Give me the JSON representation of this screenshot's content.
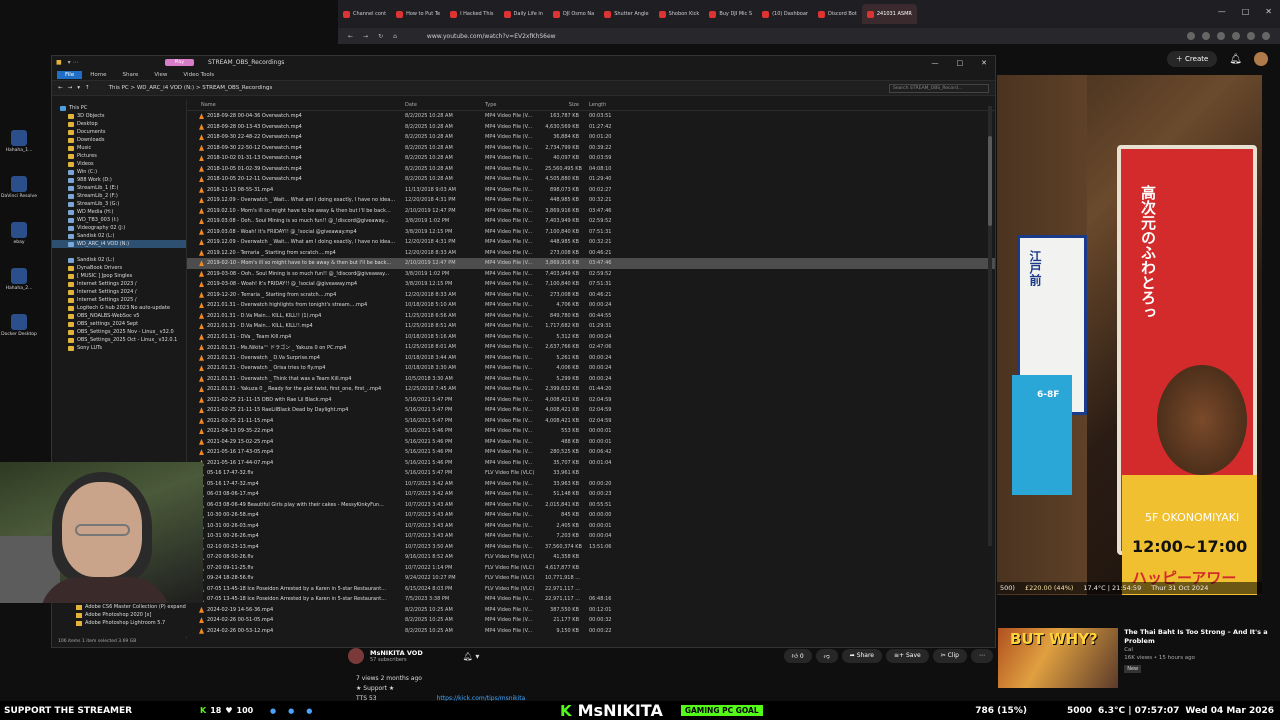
{
  "browser": {
    "tabs": [
      {
        "label": "Channel cont"
      },
      {
        "label": "How to Put Te"
      },
      {
        "label": "I Hacked This"
      },
      {
        "label": "Daily Life in"
      },
      {
        "label": "DJI Osmo Na"
      },
      {
        "label": "Shutter Angle"
      },
      {
        "label": "Shobon Kick"
      },
      {
        "label": "Buy DJI Mic S"
      },
      {
        "label": "(10) Dashboar"
      },
      {
        "label": "Discord Bot"
      },
      {
        "label": "241031 ASMR"
      }
    ],
    "url": "www.youtube.com/watch?v=EV2xfKhS6ew"
  },
  "desktop_icons": [
    {
      "label": "Hahaha_1..."
    },
    {
      "label": "DaVinci Resolve"
    },
    {
      "label": "ebay"
    },
    {
      "label": "Hahaha_2..."
    },
    {
      "label": "Docker Desktop"
    }
  ],
  "youtube": {
    "create_label": "Create",
    "channel_name": "MsNIKITA VOD",
    "subscribers": "57 subscribers",
    "like_count": "0",
    "share_label": "Share",
    "save_label": "Save",
    "clip_label": "Clip",
    "views_line": "7 views  2 months ago",
    "support_line": "★ Support ★",
    "tts_line": "TTS 53",
    "kick_link": "https://kick.com/tips/msnikita",
    "reco_title": "The Thai Baht Is Too Strong – And It's a Problem",
    "reco_channel": "Cal",
    "reco_meta": "16K views • 15 hours ago",
    "reco_badge": "New",
    "reco_thumb_text": "BUT WHY?"
  },
  "video": {
    "jp_top": "高次元のふわとろっ",
    "jp_edo": "江戸前",
    "floor": "5F OKONOMIYAKI",
    "floor_label": "6-8F",
    "time_text": "12:00~17:00",
    "happy": "ハッピーアワー",
    "overlay_money": "£220.00 (44%)",
    "overlay_left": "500)",
    "overlay_weather": "17.4°C | 21:54:59",
    "overlay_date": "Thur 31 Oct 2024"
  },
  "explorer": {
    "pin_label": "Play",
    "title": "STREAM_OBS_Recordings",
    "ribbon": [
      "File",
      "Home",
      "Share",
      "View",
      "Video Tools"
    ],
    "breadcrumb": "This PC  >  WD_ARC_i4 VOD (N:)  >  STREAM_OBS_Recordings",
    "search_placeholder": "Search STREAM_OBS_Record...",
    "columns": {
      "name": "Name",
      "date": "Date",
      "type": "Type",
      "size": "Size",
      "length": "Length"
    },
    "nav_items": [
      {
        "label": "This PC",
        "kind": "pc"
      },
      {
        "label": "3D Objects",
        "kind": "folder"
      },
      {
        "label": "Desktop",
        "kind": "folder"
      },
      {
        "label": "Documents",
        "kind": "folder"
      },
      {
        "label": "Downloads",
        "kind": "folder"
      },
      {
        "label": "Music",
        "kind": "folder"
      },
      {
        "label": "Pictures",
        "kind": "folder"
      },
      {
        "label": "Videos",
        "kind": "folder"
      },
      {
        "label": "Win (C:)",
        "kind": "drive"
      },
      {
        "label": "988 Work (D:)",
        "kind": "drive"
      },
      {
        "label": "StreamLib_1 (E:)",
        "kind": "drive"
      },
      {
        "label": "StreamLib_2 (F:)",
        "kind": "drive"
      },
      {
        "label": "StreamLib_3 (G:)",
        "kind": "drive"
      },
      {
        "label": "WD Media (H:)",
        "kind": "drive"
      },
      {
        "label": "WD_TB3_003 (I:)",
        "kind": "drive"
      },
      {
        "label": "Videography 02 (J:)",
        "kind": "drive"
      },
      {
        "label": "Sandisk 02 (L:)",
        "kind": "drive"
      },
      {
        "label": "WD_ARC_i4 VOD (N:)",
        "kind": "drive",
        "selected": true
      },
      {
        "label": "",
        "kind": "spacer"
      },
      {
        "label": "Sandisk 02 (L:)",
        "kind": "drive"
      },
      {
        "label": "DynaBook Drivers",
        "kind": "folder"
      },
      {
        "label": "[ MUSIC ] Jpop Singles",
        "kind": "folder"
      },
      {
        "label": "Internet Settings 2023 /",
        "kind": "folder"
      },
      {
        "label": "Internet Settings 2024 /",
        "kind": "folder"
      },
      {
        "label": "Internet Settings 2025 /",
        "kind": "folder"
      },
      {
        "label": "Logitech G hub 2023 No auto-update",
        "kind": "folder"
      },
      {
        "label": "OBS_NOALBS-WebSoc v5",
        "kind": "folder"
      },
      {
        "label": "OBS_settings_2024 Sept",
        "kind": "folder"
      },
      {
        "label": "OBS_Settings_2025 Nov - Linux_ v32.0",
        "kind": "folder"
      },
      {
        "label": "OBS_Settings_2025 Oct - Linux_ v32.0.1",
        "kind": "folder"
      },
      {
        "label": "Sony LUTs",
        "kind": "folder"
      }
    ],
    "files": [
      {
        "name": "2018-09-28 00-04-36 Overwatch.mp4",
        "date": "8/2/2025 10:28 AM",
        "type": "MP4 Video File (V...",
        "size": "163,787 KB",
        "length": "00:03:51"
      },
      {
        "name": "2018-09-28 00-13-43 Overwatch.mp4",
        "date": "8/2/2025 10:28 AM",
        "type": "MP4 Video File (V...",
        "size": "4,630,569 KB",
        "length": "01:27:42"
      },
      {
        "name": "2018-09-30 22-48-22 Overwatch.mp4",
        "date": "8/2/2025 10:28 AM",
        "type": "MP4 Video File (V...",
        "size": "36,884 KB",
        "length": "00:01:20"
      },
      {
        "name": "2018-09-30 22-50-12 Overwatch.mp4",
        "date": "8/2/2025 10:28 AM",
        "type": "MP4 Video File (V...",
        "size": "2,734,799 KB",
        "length": "00:39:22"
      },
      {
        "name": "2018-10-02 01-31-13 Overwatch.mp4",
        "date": "8/2/2025 10:28 AM",
        "type": "MP4 Video File (V...",
        "size": "40,097 KB",
        "length": "00:03:59"
      },
      {
        "name": "2018-10-05 01-02-39 Overwatch.mp4",
        "date": "8/2/2025 10:28 AM",
        "type": "MP4 Video File (V...",
        "size": "25,560,495 KB",
        "length": "04:08:10"
      },
      {
        "name": "2018-10-05 20-12-11 Overwatch.mp4",
        "date": "8/2/2025 10:28 AM",
        "type": "MP4 Video File (V...",
        "size": "4,505,880 KB",
        "length": "01:29:40"
      },
      {
        "name": "2018-11-13 08-55-31.mp4",
        "date": "11/13/2018 9:03 AM",
        "type": "MP4 Video File (V...",
        "size": "898,073 KB",
        "length": "00:02:27"
      },
      {
        "name": "2019.12.09 - Overwatch _ Wait... What am I doing exactly, I have no idea...",
        "date": "12/20/2018 4:31 PM",
        "type": "MP4 Video File (V...",
        "size": "448,985 KB",
        "length": "00:32:21"
      },
      {
        "name": "2019.02.10 - Mom's ill so might have to be away & then but I'll be back...",
        "date": "2/10/2019 12:47 PM",
        "type": "MP4 Video File (V...",
        "size": "3,869,916 KB",
        "length": "03:47:46"
      },
      {
        "name": "2019.03.08 - Ooh.. Soul Mining is so much fun!! @_!discord@giveaway...",
        "date": "3/8/2019 1:02 PM",
        "type": "MP4 Video File (V...",
        "size": "7,403,949 KB",
        "length": "02:59:52"
      },
      {
        "name": "2019.03.08 - Woah! It's FRIDAY!! @_!social @giveaway.mp4",
        "date": "3/8/2019 12:15 PM",
        "type": "MP4 Video File (V...",
        "size": "7,100,840 KB",
        "length": "07:51:31"
      },
      {
        "name": "2019.12.09 - Overwatch _ Wait... What am I doing exactly, I have no idea...",
        "date": "12/20/2018 4:31 PM",
        "type": "MP4 Video File (V...",
        "size": "448,985 KB",
        "length": "00:32:21"
      },
      {
        "name": "2019.12.20 - Terraria _ Starting from scratch....mp4",
        "date": "12/20/2018 8:33 AM",
        "type": "MP4 Video File (V...",
        "size": "273,008 KB",
        "length": "00:46:21"
      },
      {
        "name": "2019-02-10 - Mom's ill so might have to be away & then but I'll be back...",
        "date": "2/10/2019 12:47 PM",
        "type": "MP4 Video File (V...",
        "size": "3,869,916 KB",
        "length": "03:47:46",
        "selected": true
      },
      {
        "name": "2019-03-08 - Ooh.. Soul Mining is so much fun!! @_!discord@giveaway...",
        "date": "3/8/2019 1:02 PM",
        "type": "MP4 Video File (V...",
        "size": "7,403,949 KB",
        "length": "02:59:52"
      },
      {
        "name": "2019-03-08 - Woah! It's FRIDAY!! @_!social @giveaway.mp4",
        "date": "3/8/2019 12:15 PM",
        "type": "MP4 Video File (V...",
        "size": "7,100,840 KB",
        "length": "07:51:31"
      },
      {
        "name": "2019-12-20 - Terraria _ Starting from scratch....mp4",
        "date": "12/20/2018 8:33 AM",
        "type": "MP4 Video File (V...",
        "size": "273,008 KB",
        "length": "00:46:21"
      },
      {
        "name": "2021.01.31 - Overwatch highlights from tonight's stream....mp4",
        "date": "10/18/2018 5:10 AM",
        "type": "MP4 Video File (V...",
        "size": "4,706 KB",
        "length": "00:00:24"
      },
      {
        "name": "2021.01.31 - D.Va Main... KILL, KILL!! (1).mp4",
        "date": "11/25/2018 6:56 AM",
        "type": "MP4 Video File (V...",
        "size": "849,780 KB",
        "length": "00:44:55"
      },
      {
        "name": "2021.01.31 - D.Va Main... KILL, KILL!!.mp4",
        "date": "11/25/2018 8:51 AM",
        "type": "MP4 Video File (V...",
        "size": "1,717,682 KB",
        "length": "01:29:31"
      },
      {
        "name": "2021.01.31 - DVa _ Team Kill.mp4",
        "date": "10/18/2018 5:16 AM",
        "type": "MP4 Video File (V...",
        "size": "5,312 KB",
        "length": "00:00:24"
      },
      {
        "name": "2021.01.31 - Ms.Nikita™ ドラゴン _ Yakuza 0 on PC.mp4",
        "date": "11/25/2018 8:01 AM",
        "type": "MP4 Video File (V...",
        "size": "2,637,766 KB",
        "length": "02:47:06"
      },
      {
        "name": "2021.01.31 - Overwatch _ D.Va Surprise.mp4",
        "date": "10/18/2018 3:44 AM",
        "type": "MP4 Video File (V...",
        "size": "5,261 KB",
        "length": "00:00:24"
      },
      {
        "name": "2021.01.31 - Overwatch _ Orisa tries to fly.mp4",
        "date": "10/18/2018 3:30 AM",
        "type": "MP4 Video File (V...",
        "size": "4,006 KB",
        "length": "00:00:24"
      },
      {
        "name": "2021.01.31 - Overwatch _ Think that was a Team Kill.mp4",
        "date": "10/5/2018 3:30 AM",
        "type": "MP4 Video File (V...",
        "size": "5,299 KB",
        "length": "00:00:24"
      },
      {
        "name": "2021.01.31 - Yakuza 0 _ Ready for the plot twist, first_one, first_..mp4",
        "date": "12/25/2018 7:45 AM",
        "type": "MP4 Video File (V...",
        "size": "2,399,632 KB",
        "length": "01:44:20"
      },
      {
        "name": "2021-02-25 21-11-15 DBD with Rae Lil Black.mp4",
        "date": "5/16/2021 5:47 PM",
        "type": "MP4 Video File (V...",
        "size": "4,008,421 KB",
        "length": "02:04:59"
      },
      {
        "name": "2021-02-25 21-11-15 RaeLilBlack Dead by Daylight.mp4",
        "date": "5/16/2021 5:47 PM",
        "type": "MP4 Video File (V...",
        "size": "4,008,421 KB",
        "length": "02:04:59"
      },
      {
        "name": "2021-02-25 21-11-15.mp4",
        "date": "5/16/2021 5:47 PM",
        "type": "MP4 Video File (V...",
        "size": "4,008,421 KB",
        "length": "02:04:59"
      },
      {
        "name": "2021-04-13 09-35-22.mp4",
        "date": "5/16/2021 5:46 PM",
        "type": "MP4 Video File (V...",
        "size": "553 KB",
        "length": "00:00:01"
      },
      {
        "name": "2021-04-29 15-02-25.mp4",
        "date": "5/16/2021 5:46 PM",
        "type": "MP4 Video File (V...",
        "size": "488 KB",
        "length": "00:00:01"
      },
      {
        "name": "2021-05-16 17-43-05.mp4",
        "date": "5/16/2021 5:46 PM",
        "type": "MP4 Video File (V...",
        "size": "280,525 KB",
        "length": "00:06:42"
      },
      {
        "name": "2021-05-16 17-44-07.mp4",
        "date": "5/16/2021 5:46 PM",
        "type": "MP4 Video File (V...",
        "size": "35,707 KB",
        "length": "00:01:04"
      },
      {
        "name": "05-16 17-47-32.flv",
        "date": "5/16/2021 5:47 PM",
        "type": "FLV Video File (VLC)",
        "size": "33,961 KB",
        "length": ""
      },
      {
        "name": "05-16 17-47-32.mp4",
        "date": "10/7/2023 3:42 AM",
        "type": "MP4 Video File (V...",
        "size": "33,963 KB",
        "length": "00:00:20"
      },
      {
        "name": "06-03 08-06-17.mp4",
        "date": "10/7/2023 3:42 AM",
        "type": "MP4 Video File (V...",
        "size": "51,148 KB",
        "length": "00:00:23"
      },
      {
        "name": "06-03 08-06-49 Beautiful Girls play with their cakes - MessyKinkyFun...",
        "date": "10/7/2023 3:43 AM",
        "type": "MP4 Video File (V...",
        "size": "2,015,841 KB",
        "length": "00:55:51"
      },
      {
        "name": "10-30 00-26-58.mp4",
        "date": "10/7/2023 3:43 AM",
        "type": "MP4 Video File (V...",
        "size": "845 KB",
        "length": "00:00:00"
      },
      {
        "name": "10-31 00-26-03.mp4",
        "date": "10/7/2023 3:43 AM",
        "type": "MP4 Video File (V...",
        "size": "2,405 KB",
        "length": "00:00:01"
      },
      {
        "name": "10-31 00-26-26.mp4",
        "date": "10/7/2023 3:43 AM",
        "type": "MP4 Video File (V...",
        "size": "7,203 KB",
        "length": "00:00:04"
      },
      {
        "name": "02-10 00-23-13.mp4",
        "date": "10/7/2023 3:50 AM",
        "type": "MP4 Video File (V...",
        "size": "37,560,374 KB",
        "length": "13:51:06"
      },
      {
        "name": "07-20 08-50-26.flv",
        "date": "9/16/2021 8:52 AM",
        "type": "FLV Video File (VLC)",
        "size": "41,358 KB",
        "length": ""
      },
      {
        "name": "07-20 09-11-25.flv",
        "date": "10/7/2022 1:14 PM",
        "type": "FLV Video File (VLC)",
        "size": "4,617,877 KB",
        "length": ""
      },
      {
        "name": "09-24 18-28-56.flv",
        "date": "9/24/2022 10:27 PM",
        "type": "FLV Video File (VLC)",
        "size": "10,771,918 ...",
        "length": ""
      },
      {
        "name": "07-05 13-45-18 Ice Poseidon Arrested by a Karen in 5-star Restaurant...",
        "date": "6/15/2024 8:03 PM",
        "type": "FLV Video File (VLC)",
        "size": "22,971,117 ...",
        "length": ""
      },
      {
        "name": "07-05 13-45-18 Ice Poseidon Arrested by a Karen in 5-star Restaurant...",
        "date": "7/5/2023 3:38 PM",
        "type": "MP4 Video File (V...",
        "size": "22,971,117 ...",
        "length": "06:48:16"
      },
      {
        "name": "2024-02-19 14-56-36.mp4",
        "date": "8/2/2025 10:25 AM",
        "type": "MP4 Video File (V...",
        "size": "387,550 KB",
        "length": "00:12:01"
      },
      {
        "name": "2024-02-26 00-51-05.mp4",
        "date": "8/2/2025 10:25 AM",
        "type": "MP4 Video File (V...",
        "size": "21,177 KB",
        "length": "00:00:32"
      },
      {
        "name": "2024-02-26 00-53-12.mp4",
        "date": "8/2/2025 10:25 AM",
        "type": "MP4 Video File (V...",
        "size": "9,150 KB",
        "length": "00:00:22"
      }
    ],
    "status": "106 items   1 item selected  3.69 GB"
  },
  "side_apps": [
    {
      "label": "Adobe CS6 Master Collection (P) expand"
    },
    {
      "label": "Adobe Photoshop 2020 [x]"
    },
    {
      "label": "Adobe Photoshop Lightroom 5.7"
    }
  ],
  "taskbar": {
    "support": "SUPPORT THE STREAMER",
    "count_a": "18",
    "count_b": "100",
    "kick_name": "MsNIKITA",
    "goal_label": "GAMING PC GOAL",
    "goal_pct": "786 (15%)",
    "stat_a": "5000",
    "weather": "6.3°C | 07:57:07",
    "date": "Wed 04 Mar 2026"
  }
}
